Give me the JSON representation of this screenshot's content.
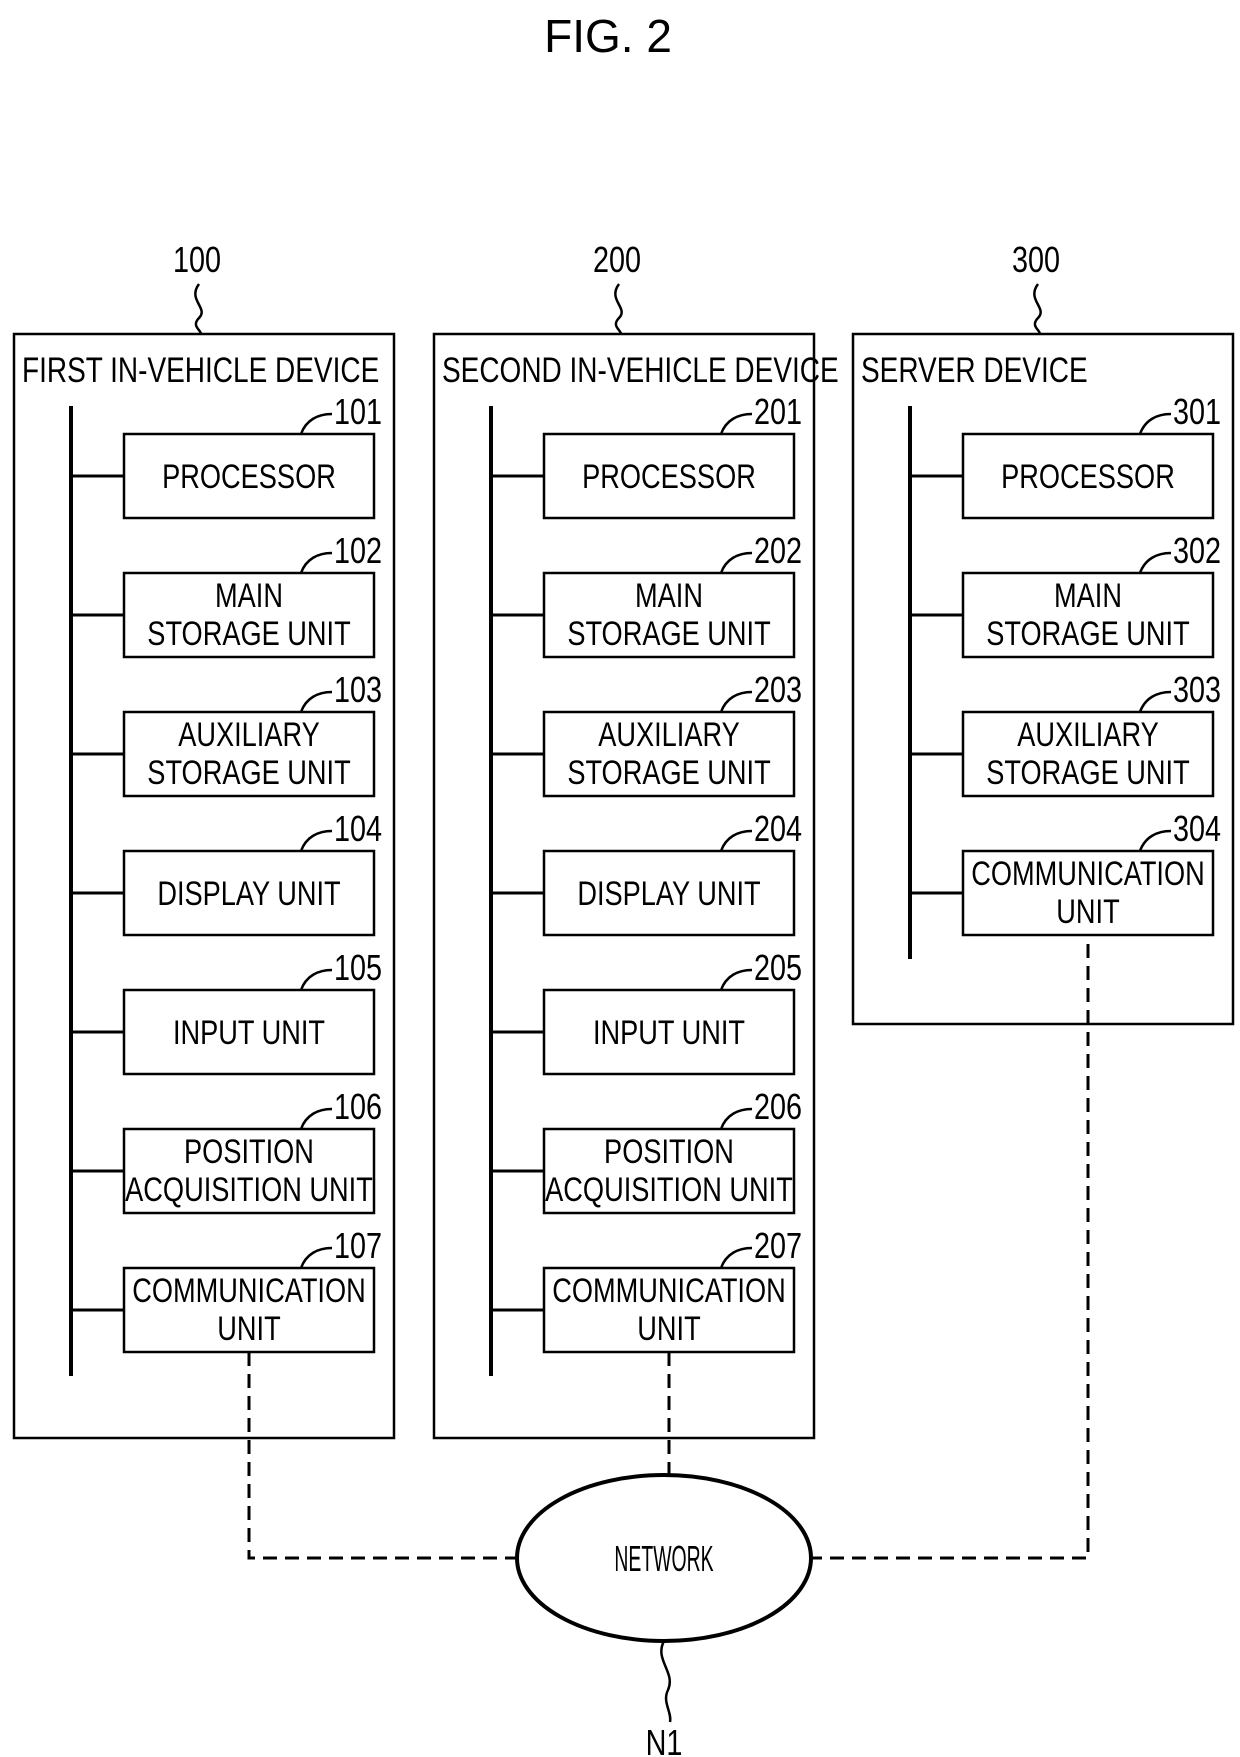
{
  "figure": {
    "title": "FIG. 2"
  },
  "devices": [
    {
      "ref": "100",
      "name": "FIRST IN-VEHICLE DEVICE",
      "units": [
        {
          "ref": "101",
          "lines": [
            "PROCESSOR"
          ]
        },
        {
          "ref": "102",
          "lines": [
            "MAIN",
            "STORAGE UNIT"
          ]
        },
        {
          "ref": "103",
          "lines": [
            "AUXILIARY",
            "STORAGE UNIT"
          ]
        },
        {
          "ref": "104",
          "lines": [
            "DISPLAY UNIT"
          ]
        },
        {
          "ref": "105",
          "lines": [
            "INPUT UNIT"
          ]
        },
        {
          "ref": "106",
          "lines": [
            "POSITION",
            "ACQUISITION UNIT"
          ]
        },
        {
          "ref": "107",
          "lines": [
            "COMMUNICATION",
            "UNIT"
          ]
        }
      ]
    },
    {
      "ref": "200",
      "name": "SECOND IN-VEHICLE DEVICE",
      "units": [
        {
          "ref": "201",
          "lines": [
            "PROCESSOR"
          ]
        },
        {
          "ref": "202",
          "lines": [
            "MAIN",
            "STORAGE UNIT"
          ]
        },
        {
          "ref": "203",
          "lines": [
            "AUXILIARY",
            "STORAGE UNIT"
          ]
        },
        {
          "ref": "204",
          "lines": [
            "DISPLAY UNIT"
          ]
        },
        {
          "ref": "205",
          "lines": [
            "INPUT UNIT"
          ]
        },
        {
          "ref": "206",
          "lines": [
            "POSITION",
            "ACQUISITION UNIT"
          ]
        },
        {
          "ref": "207",
          "lines": [
            "COMMUNICATION",
            "UNIT"
          ]
        }
      ]
    },
    {
      "ref": "300",
      "name": "SERVER DEVICE",
      "units": [
        {
          "ref": "301",
          "lines": [
            "PROCESSOR"
          ]
        },
        {
          "ref": "302",
          "lines": [
            "MAIN",
            "STORAGE UNIT"
          ]
        },
        {
          "ref": "303",
          "lines": [
            "AUXILIARY",
            "STORAGE UNIT"
          ]
        },
        {
          "ref": "304",
          "lines": [
            "COMMUNICATION",
            "UNIT"
          ]
        }
      ]
    }
  ],
  "network": {
    "label": "NETWORK",
    "ref": "N1"
  },
  "colors": {
    "line": "#000000",
    "background": "#ffffff"
  }
}
